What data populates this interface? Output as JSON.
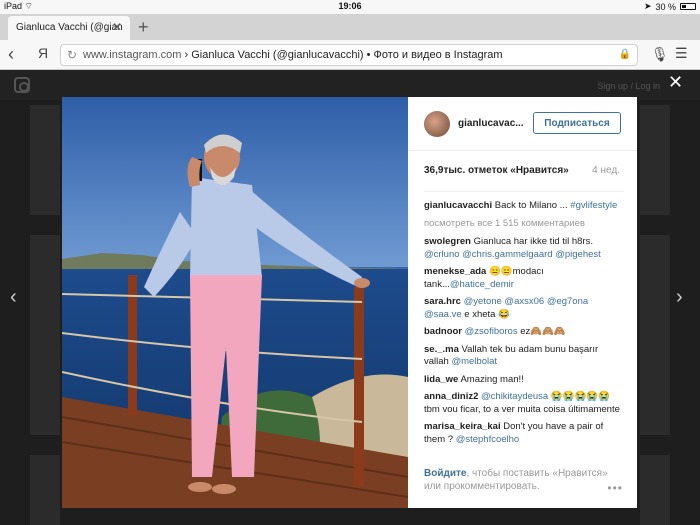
{
  "status_bar": {
    "device": "iPad",
    "time": "19:06",
    "battery": "30 %"
  },
  "tab": {
    "title": "Gianluca Vacchi (@gian",
    "close": "✕",
    "new_tab": "+"
  },
  "toolbar": {
    "yandex_label": "Я",
    "url_domain": "www.instagram.com",
    "url_sep": " › ",
    "url_title": "Gianluca Vacchi (@gianlucavacchi) • Фото и видео в Instagram"
  },
  "instagram": {
    "auth": "Sign up / Log in"
  },
  "post": {
    "username": "gianlucavac...",
    "follow_label": "Подписаться",
    "likes": "36,9тыс. отметок «Нравится»",
    "age": "4 нед.",
    "caption_user": "gianlucavacchi",
    "caption_text": " Back to Milano ... ",
    "caption_tag": "#gvlifestyle",
    "view_all": "посмотреть все 1 515 комментариев",
    "comments": [
      {
        "user": "swolegren",
        "text": " Gianluca har ikke tid til h8rs. ",
        "mentions": "@crluno @chris.gammelgaard @pigehest"
      },
      {
        "user": "menekse_ada",
        "text": " 😑😑modacı tank...",
        "mentions": "@hatice_demir"
      },
      {
        "user": "sara.hrc",
        "text": " ",
        "mentions": "@yetone @axsx06 @eg7ona @saa.ve",
        "tail": " e xheta 😂"
      },
      {
        "user": "badnoor",
        "text": " ",
        "mentions": "@zsofiboros",
        "tail": " ez🙈🙈🙈"
      },
      {
        "user": "se._.ma",
        "text": " Vallah tek bu adam bunu başarır vallah ",
        "mentions": "@melbolat"
      },
      {
        "user": "lida_we",
        "text": " Amazing man!!",
        "mentions": ""
      },
      {
        "user": "anna_diniz2",
        "text": " ",
        "mentions": "@chikitaydeusa",
        "tail": " 😭😭😭😭😭 tbm vou ficar, to a ver muita coisa últimamente"
      },
      {
        "user": "marisa_keira_kai",
        "text": " Don't you have a pair of them ? ",
        "mentions": "@stephfcoelho"
      }
    ],
    "login_link": "Войдите",
    "login_text": ", чтобы поставить «Нравится» или прокомментировать.",
    "more_dots": "•••"
  }
}
